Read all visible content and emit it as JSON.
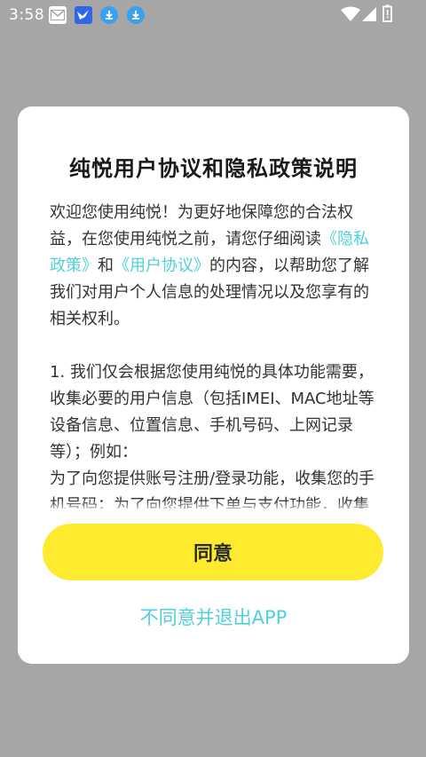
{
  "status_bar": {
    "time": "3:58",
    "icons": [
      "mail-icon",
      "bird-app-icon",
      "download-icon",
      "download-icon",
      "wifi-icon",
      "signal-icon",
      "battery-icon"
    ]
  },
  "dialog": {
    "title": "纯悦用户协议和隐私政策说明",
    "intro": {
      "text_1": "欢迎您使用纯悦！为更好地保障您的合法权益，在您使用纯悦之前，请您仔细阅读",
      "privacy_link": "《隐私政策》",
      "text_2": "和",
      "user_agreement_link": "《用户协议》",
      "text_3": "的内容，以帮助您了解我们对用户个人信息的处理情况以及您享有的相关权利。"
    },
    "section_1": "1. 我们仅会根据您使用纯悦的具体功能需要，收集必要的用户信息（包括IMEI、MAC地址等设备信息、位置信息、手机号码、上网记录等）；例如：",
    "section_1_detail": "为了向您提供账号注册/登录功能，收集您的手机号码；为了向您提供下单与支付功能，收集您的订单信息、支付方式；您可查",
    "agree_label": "同意",
    "disagree_label": "不同意并退出APP"
  },
  "colors": {
    "overlay": "#a6a6a6",
    "accent_link": "#4fd0dc",
    "agree_button": "#ffeb2e"
  }
}
